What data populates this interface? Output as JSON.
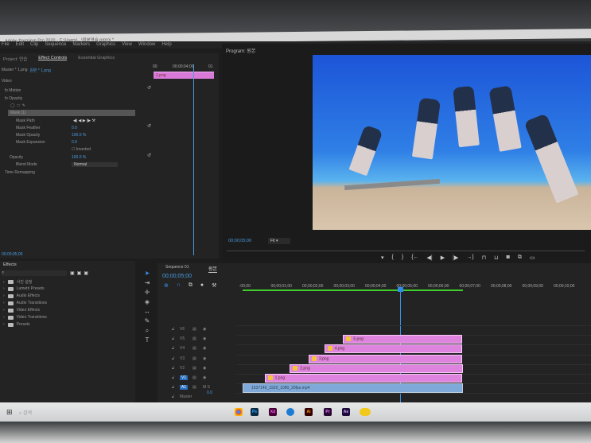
{
  "window": {
    "title": "Adobe Premiere Pro 2020 - C:\\Users\\...\\원본연습.prproj *"
  },
  "menu": [
    "File",
    "Edit",
    "Clip",
    "Sequence",
    "Markers",
    "Graphics",
    "View",
    "Window",
    "Help"
  ],
  "left_tabs": [
    "Project: 연습",
    "Effect Controls",
    "Essential Graphics"
  ],
  "effect_controls": {
    "source": "Master * 1.png",
    "clip": "원본 * 1.png",
    "section": "Video",
    "mini_ruler": {
      "start": "00",
      "mid": "00;00;04;00",
      "end": "01"
    },
    "mini_clip": "1.png",
    "rows": [
      {
        "label": "Motion"
      },
      {
        "label": "Opacity"
      },
      {
        "label": "Mask (1)"
      },
      {
        "label": "Mask Path"
      },
      {
        "label": "Mask Feather",
        "value": "0.0"
      },
      {
        "label": "Mask Opacity",
        "value": "100.0 %"
      },
      {
        "label": "Mask Expansion",
        "value": "0.0"
      },
      {
        "label": "Inverted"
      },
      {
        "label": "Opacity",
        "value": "100.0 %"
      },
      {
        "label": "Blend Mode",
        "value": "Normal"
      },
      {
        "label": "Time Remapping"
      }
    ],
    "timecode": "00;00;05;00"
  },
  "program": {
    "title": "Program: 원본",
    "timecode": "00;00;05;00",
    "zoom": "Fit"
  },
  "effects_panel": {
    "title": "Effects",
    "items": [
      "사진 설정",
      "Lumetri Presets",
      "Audio Effects",
      "Audio Transitions",
      "Video Effects",
      "Video Transitions",
      "Presets"
    ]
  },
  "timeline": {
    "tabs": [
      "Sequence 01",
      "원본"
    ],
    "timecode": "00;00;05;00",
    "ruler": [
      ":00;00",
      "00;00;01;00",
      "00;00;02;00",
      "00;00;03;00",
      "00;00;04;00",
      "00;00;05;00",
      "00;00;06;00",
      "00;00;07;00",
      "00;00;08;00",
      "00;00;09;00",
      "00;00;10;00"
    ],
    "playhead_seconds": 5,
    "tracks": [
      "V6",
      "V5",
      "V4",
      "V3",
      "V2",
      "V1",
      "A1",
      "Master"
    ],
    "master_value": "0.0",
    "clips": [
      {
        "name": "5.png",
        "track": 1,
        "start": 3.2,
        "end": 7.0
      },
      {
        "name": "4.png",
        "track": 2,
        "start": 2.6,
        "end": 7.0
      },
      {
        "name": "3.png",
        "track": 3,
        "start": 2.1,
        "end": 7.0
      },
      {
        "name": "2.png",
        "track": 4,
        "start": 1.5,
        "end": 7.0
      },
      {
        "name": "1.png",
        "track": 5,
        "start": 0.7,
        "end": 7.0
      }
    ],
    "audio_clip": {
      "name": "1537146_1920_1080_30fps.mp4",
      "start": 0,
      "end": 7.0
    }
  },
  "taskbar": {
    "search_placeholder": "검색",
    "apps": [
      "Ps",
      "Xd",
      "Ai",
      "Pr",
      "Ae"
    ]
  },
  "colors": {
    "accent": "#2d8ceb",
    "clip_pink": "#de83de",
    "audio_blue": "#7fa9d9",
    "render_green": "#3fcf2a"
  }
}
